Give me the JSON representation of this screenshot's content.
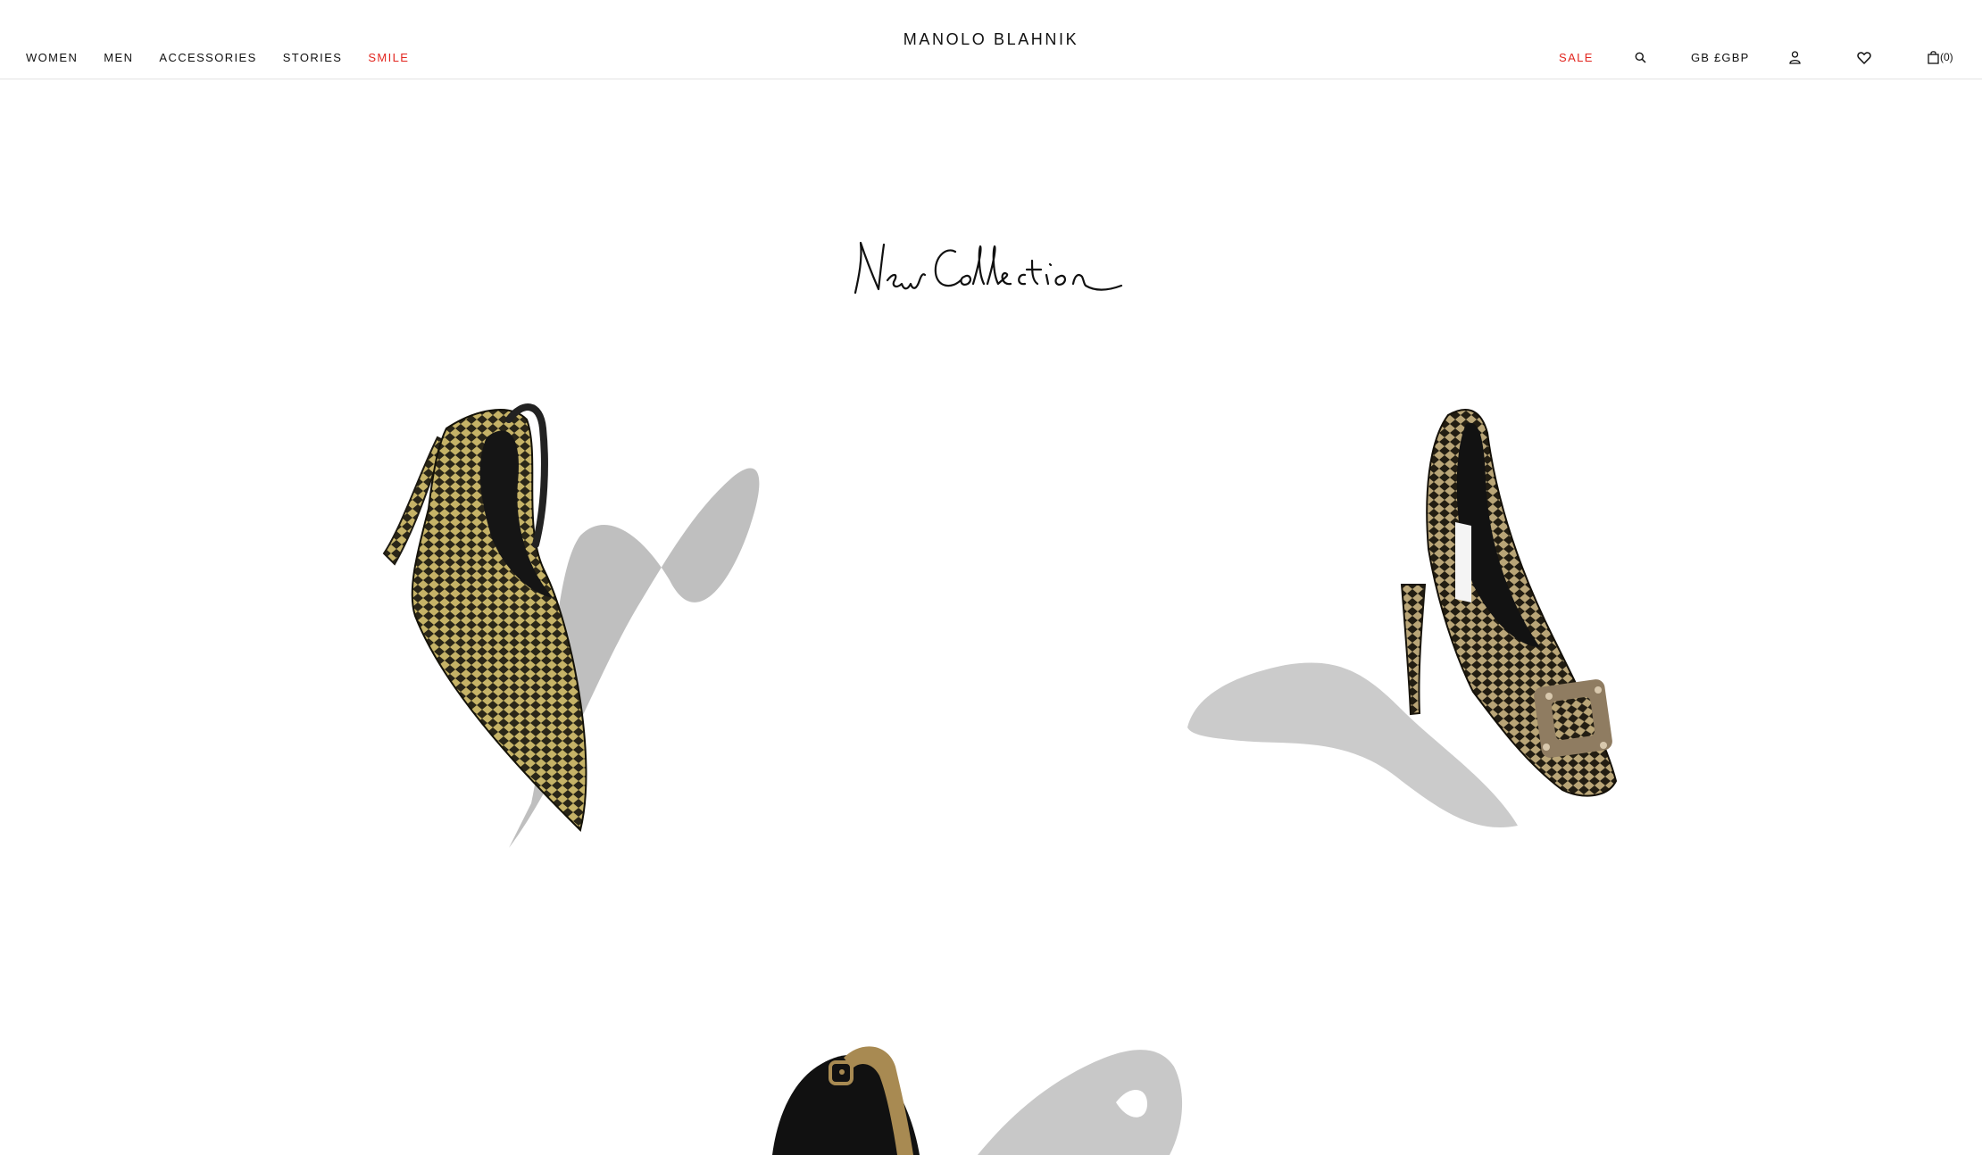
{
  "header": {
    "brand": "MANOLO BLAHNIK",
    "nav_left": [
      {
        "label": "WOMEN"
      },
      {
        "label": "MEN"
      },
      {
        "label": "ACCESSORIES"
      },
      {
        "label": "STORIES"
      },
      {
        "label": "SMILE"
      }
    ],
    "sale_label": "SALE",
    "currency_label": "GB £GBP",
    "bag_count": "(0)",
    "icons": [
      "search-icon",
      "account-icon",
      "wishlist-heart-icon",
      "shopping-bag-icon"
    ],
    "accent_color": "#e2261f"
  },
  "hero": {
    "headline_image": "New Collection handwritten script",
    "products": [
      {
        "name": "patterned-slingback-pump",
        "colors": [
          "#c6b367",
          "#2a2618"
        ]
      },
      {
        "name": "patterned-buckle-pump",
        "colors": [
          "#b9a577",
          "#221d12"
        ]
      },
      {
        "name": "black-ankle-strap-sandal",
        "colors": [
          "#111111",
          "#a88a52"
        ]
      }
    ]
  }
}
